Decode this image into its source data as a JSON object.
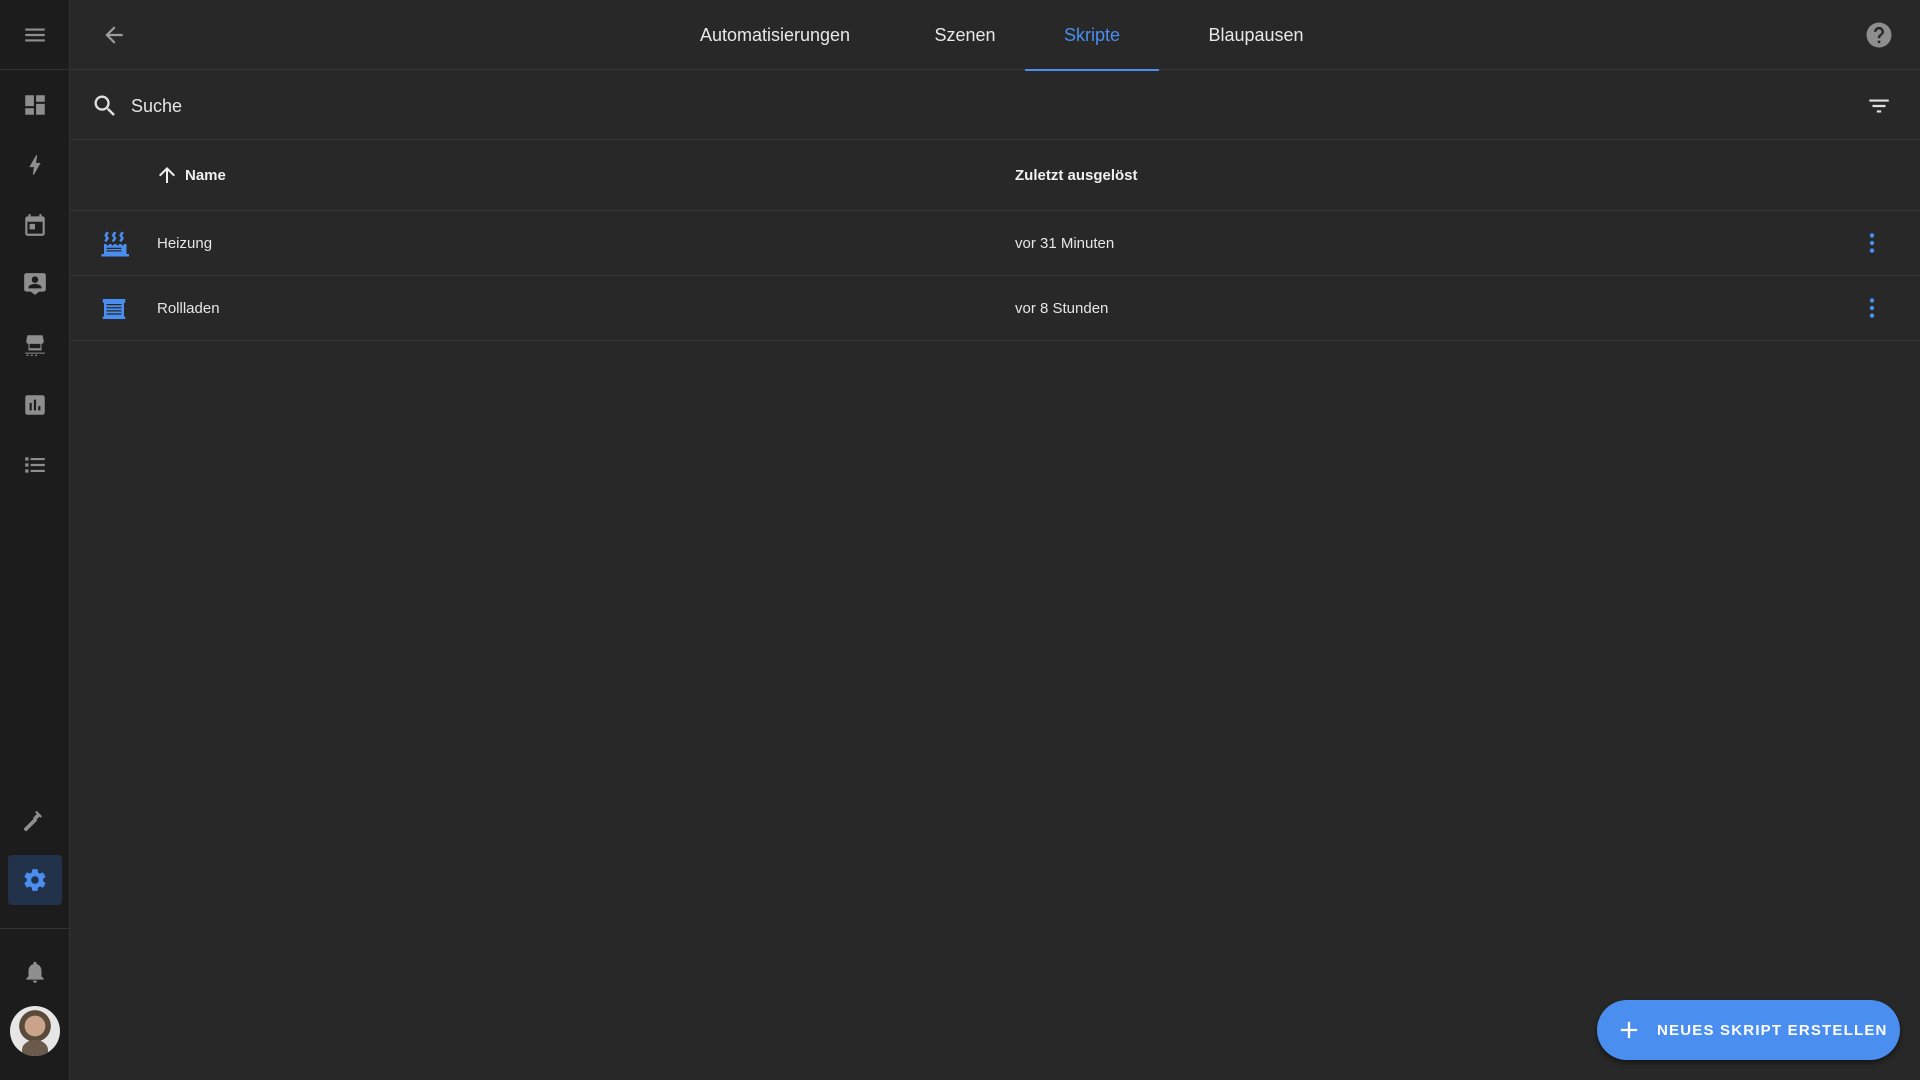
{
  "colors": {
    "accent": "#4a8ef0",
    "background": "#282828",
    "sidebar": "#1c1c1c",
    "icon_muted": "#8e8e8e"
  },
  "sidebar": {
    "menu_icon": "menu-icon",
    "items": [
      {
        "icon": "dashboard-icon"
      },
      {
        "icon": "lightning-icon"
      },
      {
        "icon": "calendar-icon"
      },
      {
        "icon": "account-box-icon"
      },
      {
        "icon": "hacs-store-icon"
      },
      {
        "icon": "chart-box-icon"
      },
      {
        "icon": "list-icon"
      },
      {
        "icon": "hammer-icon"
      },
      {
        "icon": "gear-icon",
        "active": true
      }
    ],
    "notifications_icon": "bell-icon"
  },
  "header": {
    "tabs": [
      {
        "label": "Automatisierungen",
        "active": false
      },
      {
        "label": "Szenen",
        "active": false
      },
      {
        "label": "Skripte",
        "active": true
      },
      {
        "label": "Blaupausen",
        "active": false
      }
    ]
  },
  "search": {
    "placeholder": "Suche"
  },
  "table": {
    "columns": {
      "name": "Name",
      "last_triggered": "Zuletzt ausgelöst"
    },
    "rows": [
      {
        "icon": "radiator-icon",
        "name": "Heizung",
        "last_triggered": "vor 31 Minuten"
      },
      {
        "icon": "window-shutter-icon",
        "name": "Rollladen",
        "last_triggered": "vor 8 Stunden"
      }
    ]
  },
  "fab": {
    "label": "NEUES SKRIPT ERSTELLEN"
  }
}
